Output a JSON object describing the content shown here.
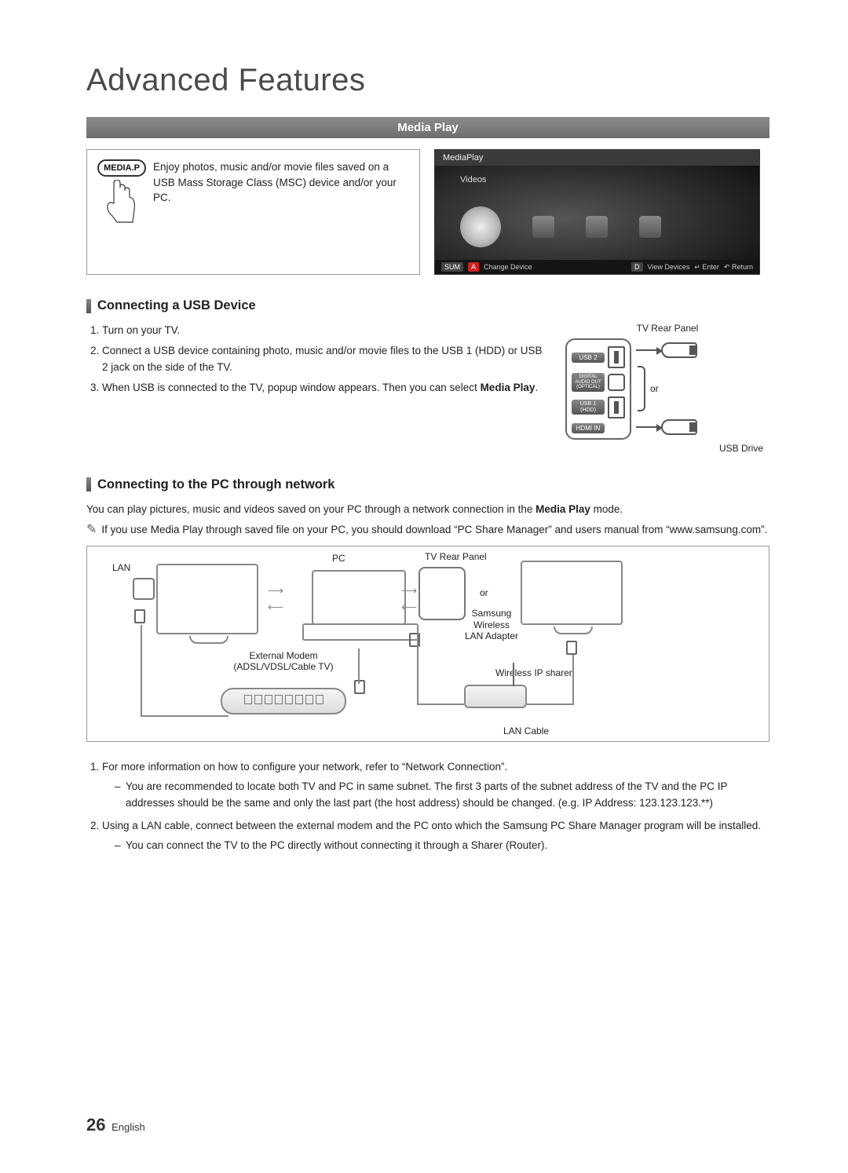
{
  "page": {
    "number": "26",
    "language": "English",
    "chapter_title": "Advanced Features"
  },
  "section": {
    "title": "Media Play",
    "intro": {
      "button_label": "MEDIA.P",
      "text": "Enjoy photos, music and/or movie files saved on a USB Mass Storage Class (MSC) device and/or your PC."
    },
    "tv_widget": {
      "title": "MediaPlay",
      "category": "Videos",
      "bottombar": {
        "left": {
          "sum": "SUM",
          "a_label": "Change Device"
        },
        "right": {
          "view": "View Devices",
          "enter": "Enter",
          "ret": "Return"
        }
      }
    }
  },
  "usb": {
    "heading": "Connecting a USB Device",
    "steps": [
      "Turn on your TV.",
      "Connect a USB device containing photo, music and/or movie files to the USB 1 (HDD) or USB 2 jack on the side of the TV.",
      "When USB is connected to the TV, popup window appears. Then you can select "
    ],
    "media_play_bold": "Media Play",
    "rear_panel_label": "TV Rear Panel",
    "ports": {
      "usb2": "USB 2",
      "optical": "DIGITAL AUDIO OUT (OPTICAL)",
      "usb1": "USB 1 (HDD)",
      "hdmi": "HDMI IN"
    },
    "or": "or",
    "usb_drive": "USB Drive"
  },
  "pc": {
    "heading": "Connecting to the PC through network",
    "para": "You can play pictures, music and videos saved on your PC through a network connection in the ",
    "para_bold": "Media Play",
    "para_after": " mode.",
    "note": "If you use Media Play through saved file on your PC, you should download “PC Share Manager” and users manual from “www.samsung.com”.",
    "diagram": {
      "lan": "LAN",
      "pc": "PC",
      "rear": "TV Rear Panel",
      "or": "or",
      "wlan": "Samsung Wireless LAN Adapter",
      "modem": "External Modem",
      "modem_sub": "(ADSL/VDSL/Cable TV)",
      "wireless_sharer": "Wireless IP sharer",
      "lan_cable": "LAN Cable"
    },
    "steps": [
      {
        "text": "For more information on how to configure your network, refer to “Network Connection”.",
        "sub": [
          "You are recommended to locate both TV and PC in same subnet. The first 3 parts of the subnet address of the TV and the PC IP addresses should be the same and only the last part (the host address) should be changed. (e.g. IP Address: 123.123.123.**)"
        ]
      },
      {
        "text": "Using a LAN cable, connect between the external modem and the PC onto which the Samsung PC Share Manager program will be installed.",
        "sub": [
          "You can connect the TV to the PC directly without connecting it through a Sharer (Router)."
        ]
      }
    ]
  }
}
